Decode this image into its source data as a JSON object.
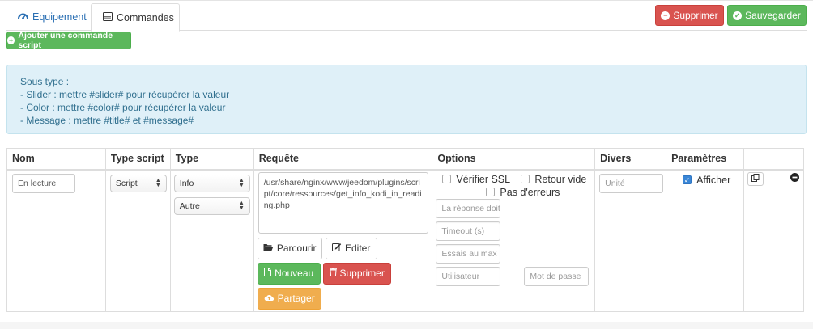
{
  "tabs": {
    "equipement": "Equipement",
    "commandes": "Commandes"
  },
  "actions": {
    "supprimer": "Supprimer",
    "sauvegarder": "Sauvegarder",
    "add_command": "Ajouter une commande script"
  },
  "info": {
    "line1": "Sous type :",
    "line2": "- Slider : mettre #slider# pour récupérer la valeur",
    "line3": "- Color : mettre #color# pour récupérer la valeur",
    "line4": "- Message : mettre #title# et #message#"
  },
  "table": {
    "headers": {
      "nom": "Nom",
      "type_script": "Type script",
      "type": "Type",
      "requete": "Requête",
      "options": "Options",
      "divers": "Divers",
      "parametres": "Paramètres"
    },
    "row": {
      "nom": "En lecture",
      "type_script": "Script",
      "type": "Info",
      "subtype": "Autre",
      "requete": "/usr/share/nginx/www/jeedom/plugins/script/core/ressources/get_info_kodi_in_reading.php",
      "buttons": {
        "parcourir": "Parcourir",
        "editer": "Editer",
        "nouveau": "Nouveau",
        "supprimer": "Supprimer",
        "partager": "Partager"
      },
      "options": {
        "verifier_ssl": "Vérifier SSL",
        "retour_vide": "Retour vide",
        "pas_erreurs": "Pas d'erreurs",
        "ph_reponse": "La réponse doit contenir",
        "ph_timeout": "Timeout (s)",
        "ph_essais": "Essais au max",
        "ph_utilisateur": "Utilisateur",
        "ph_motdepasse": "Mot de passe",
        "verifier_ssl_checked": false,
        "retour_vide_checked": false,
        "pas_erreurs_checked": false
      },
      "divers_placeholder": "Unité",
      "afficher": "Afficher",
      "afficher_checked": true
    }
  },
  "colors": {
    "danger": "#d9534f",
    "success": "#5cb85c",
    "warning": "#f0ad4e",
    "info_bg": "#dff0f8",
    "info_text": "#31708f",
    "link": "#2a6fb3"
  }
}
